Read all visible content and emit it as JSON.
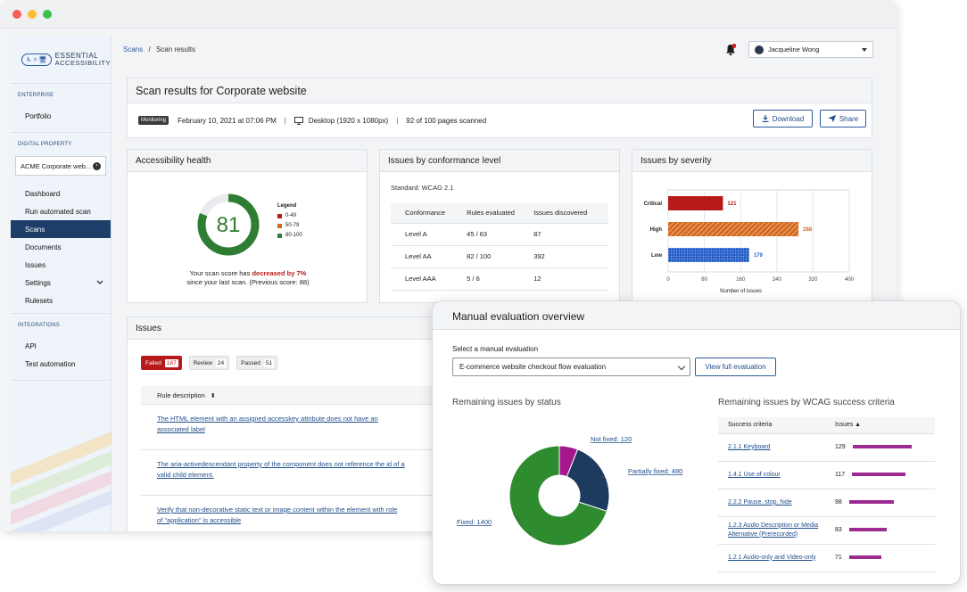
{
  "sidebar": {
    "logo": {
      "box_text": "♿ > 🖥",
      "brand_top": "ESSENTIAL",
      "brand_bottom": "ACCESSIBILITY"
    },
    "enterprise_label": "ENTERPRISE",
    "portfolio": "Portfolio",
    "digital_property_label": "DIGITAL PROPERTY",
    "property_select": "ACME Corporate web...",
    "items": [
      "Dashboard",
      "Run automated scan",
      "Scans",
      "Documents",
      "Issues",
      "Settings",
      "Rulesets"
    ],
    "integrations_label": "INTEGRATIONS",
    "integrations": [
      "API",
      "Test automation"
    ]
  },
  "topbar": {
    "crumb_link": "Scans",
    "crumb_sep": "/",
    "crumb_current": "Scan results",
    "user_name": "Jacqueline Wong"
  },
  "scan": {
    "title": "Scan results for Corporate website",
    "badge": "Monitoring",
    "date": "February 10, 2021 at 07:06 PM",
    "device": "Desktop (1920 x 1080px)",
    "pages": "92 of 100 pages scanned",
    "download": "Download",
    "share": "Share",
    "sep": "|"
  },
  "health": {
    "title": "Accessibility health",
    "score": 81,
    "score_text": "81",
    "legend_title": "Legend",
    "legend": [
      {
        "label": "0-49",
        "color": "#b71a1a"
      },
      {
        "label": "50-79",
        "color": "#d3691e"
      },
      {
        "label": "80-100",
        "color": "#2e7d32"
      }
    ],
    "msg_pre": "Your scan score has ",
    "msg_bold": "decreased by 7%",
    "msg_post": "since your last scan. (Previous score: 88)"
  },
  "conformance": {
    "title": "Issues by conformance level",
    "standard": "Standard: WCAG 2.1",
    "headers": [
      "Conformance",
      "Rules evaluated",
      "Issues discovered"
    ],
    "rows": [
      [
        "Level A",
        "45 / 63",
        "87"
      ],
      [
        "Level AA",
        "82 / 100",
        "392"
      ],
      [
        "Level AAA",
        "5 / 6",
        "12"
      ]
    ]
  },
  "severity": {
    "title": "Issues by severity",
    "colors": {
      "Critical": "#b71a1a",
      "High": "#d3691e",
      "Low": "#2a62c9"
    }
  },
  "chart_data": [
    {
      "type": "bar",
      "orientation": "horizontal",
      "categories": [
        "Critical",
        "High",
        "Low"
      ],
      "values": [
        121,
        288,
        179
      ],
      "xlabel": "Number of issues",
      "xlim": [
        0,
        400
      ],
      "xticks": [
        0,
        80,
        160,
        240,
        320,
        400
      ]
    },
    {
      "type": "pie",
      "title": "Remaining issues by status",
      "categories": [
        "Not fixed",
        "Partially fixed",
        "Fixed"
      ],
      "values": [
        120,
        480,
        1400
      ],
      "labels": [
        "Not fixed: 120",
        "Partially fixed: 480",
        "Fixed: 1400"
      ],
      "colors": [
        "#a6168f",
        "#1d3a5f",
        "#2e8b2e"
      ]
    },
    {
      "type": "bar",
      "orientation": "horizontal",
      "title": "Remaining issues by WCAG success criteria",
      "categories": [
        "2.1.1 Keyboard",
        "1.4.1 Use of colour",
        "2.2.2 Pause, stop, hide",
        "1.2.3 Audio Description or Media Alternative (Prerecorded)",
        "1.2.1 Audio-only and Video-only"
      ],
      "values": [
        129,
        117,
        98,
        83,
        71
      ]
    }
  ],
  "issues": {
    "title": "Issues",
    "tabs": [
      {
        "label": "Failed",
        "count": "187"
      },
      {
        "label": "Review",
        "count": "24"
      },
      {
        "label": "Passed",
        "count": "51"
      }
    ],
    "col_header": "Rule description",
    "rows": [
      "The HTML element with an assigned accesskey attribute does not have an associated label",
      "The aria-activedescendant property of the component does not reference the id of a valid child element.",
      "Verify that non-decorative static text or image content within the element with role of \"application\" is accessible"
    ]
  },
  "manual": {
    "title": "Manual evaluation overview",
    "select_label": "Select a manual evaluation",
    "select_value": "E-commerce website checkout flow evaluation",
    "view_button": "View full evaluation",
    "status_title": "Remaining issues by status",
    "wcag_title": "Remaining issues by WCAG success criteria",
    "wcag_headers": [
      "Success criteria",
      "Issues ▲"
    ],
    "wcag_rows": [
      [
        "2.1.1 Keyboard",
        "129"
      ],
      [
        "1.4.1 Use of colour",
        "117"
      ],
      [
        "2.2.2 Pause, stop, hide",
        "98"
      ],
      [
        "1.2.3 Audio Description or Media Alternative (Prerecorded)",
        "83"
      ],
      [
        "1.2.1 Audio-only and Video-only",
        "71"
      ]
    ]
  }
}
